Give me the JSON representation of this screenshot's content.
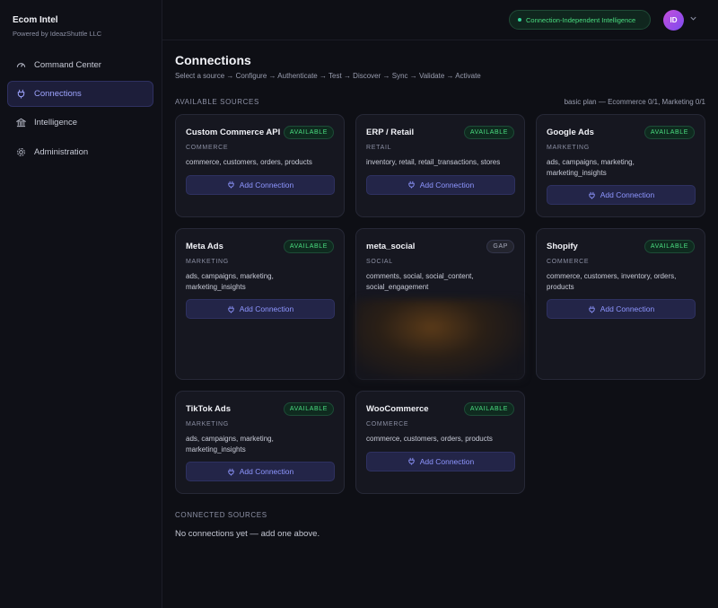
{
  "brand": {
    "title": "Ecom Intel",
    "subtitle": "Powered by IdeazShuttle LLC"
  },
  "nav": [
    {
      "label": "Command Center",
      "icon": "gauge-icon"
    },
    {
      "label": "Connections",
      "icon": "plug-icon",
      "active": true
    },
    {
      "label": "Intelligence",
      "icon": "bank-icon"
    },
    {
      "label": "Administration",
      "icon": "gear-icon"
    }
  ],
  "topbar": {
    "status_pill": "Connection-Independent Intelligence",
    "avatar_initials": "ID"
  },
  "page": {
    "title": "Connections",
    "steps": "Select a source → Configure → Authenticate → Test → Discover → Sync → Validate → Activate",
    "available_label": "AVAILABLE SOURCES",
    "plan_info": "basic plan — Ecommerce 0/1, Marketing 0/1",
    "connected_label": "CONNECTED SOURCES",
    "empty_text": "No connections yet — add one above."
  },
  "add_button_label": "Add Connection",
  "sources": [
    {
      "name": "Custom Commerce API",
      "badge": "AVAILABLE",
      "category": "COMMERCE",
      "tags": "commerce, customers, orders, products",
      "button": true
    },
    {
      "name": "ERP / Retail",
      "badge": "AVAILABLE",
      "category": "RETAIL",
      "tags": "inventory, retail, retail_transactions, stores",
      "button": true
    },
    {
      "name": "Google Ads",
      "badge": "AVAILABLE",
      "category": "MARKETING",
      "tags": "ads, campaigns, marketing, marketing_insights",
      "button": true
    },
    {
      "name": "Meta Ads",
      "badge": "AVAILABLE",
      "category": "MARKETING",
      "tags": "ads, campaigns, marketing, marketing_insights",
      "button": true
    },
    {
      "name": "meta_social",
      "badge": "GAP",
      "category": "SOCIAL",
      "tags": "comments, social, social_content, social_engagement",
      "button": false
    },
    {
      "name": "Shopify",
      "badge": "AVAILABLE",
      "category": "COMMERCE",
      "tags": "commerce, customers, inventory, orders, products",
      "button": true
    },
    {
      "name": "TikTok Ads",
      "badge": "AVAILABLE",
      "category": "MARKETING",
      "tags": "ads, campaigns, marketing, marketing_insights",
      "button": true
    },
    {
      "name": "WooCommerce",
      "badge": "AVAILABLE",
      "category": "COMMERCE",
      "tags": "commerce, customers, orders, products",
      "button": true
    }
  ],
  "colors": {
    "accent": "#8e96ff",
    "available": "#4ade80",
    "background": "#0e0f15"
  }
}
